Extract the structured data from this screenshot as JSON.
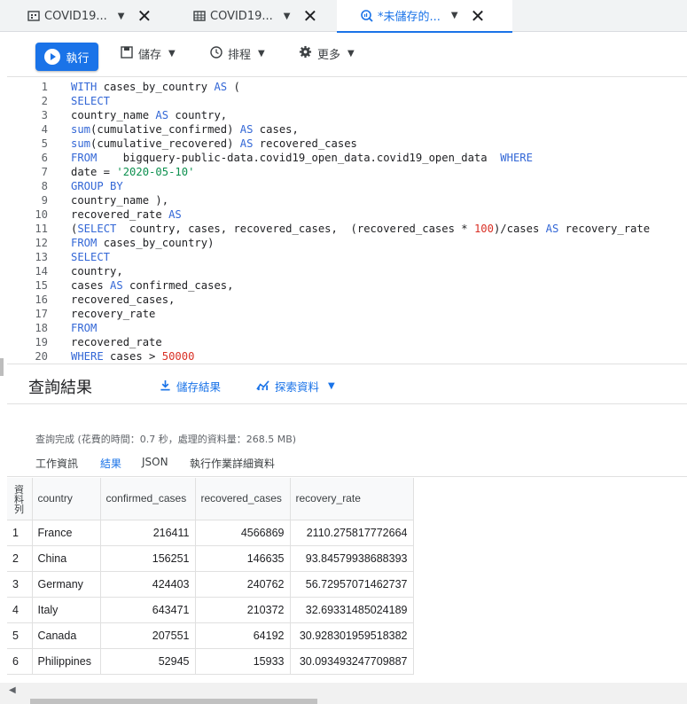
{
  "tabs": [
    {
      "label": "COVID19...",
      "icon": "dataset-icon"
    },
    {
      "label": "COVID19...",
      "icon": "table-icon"
    },
    {
      "label": "*未儲存的...",
      "icon": "query-icon"
    }
  ],
  "toolbar": {
    "run_label": "執行",
    "save_label": "儲存",
    "schedule_label": "排程",
    "more_label": "更多"
  },
  "editor": {
    "line_numbers": [
      "1",
      "2",
      "3",
      "4",
      "5",
      "6",
      "7",
      "8",
      "9",
      "10",
      "11",
      "12",
      "13",
      "14",
      "15",
      "16",
      "17",
      "18",
      "19",
      "20"
    ],
    "lines": [
      "WITH cases_by_country AS (",
      "SELECT",
      "country_name AS country,",
      "sum(cumulative_confirmed) AS cases,",
      "sum(cumulative_recovered) AS recovered_cases",
      "FROM    bigquery-public-data.covid19_open_data.covid19_open_data  WHERE",
      "date = '2020-05-10'",
      "GROUP BY",
      "country_name ),",
      "recovered_rate AS",
      "(SELECT  country, cases, recovered_cases,  (recovered_cases * 100)/cases AS recovery_rate",
      "FROM cases_by_country)",
      "SELECT",
      "country,",
      "cases AS confirmed_cases,",
      "recovered_cases,",
      "recovery_rate",
      "FROM",
      "recovered_rate",
      "WHERE cases > 50000"
    ]
  },
  "results": {
    "title": "查詢結果",
    "save_results_label": "儲存結果",
    "explore_label": "探索資料",
    "info_text": "查詢完成 (花費的時間：0.7 秒，處理的資料量：268.5 MB)",
    "subtabs": [
      "工作資訊",
      "結果",
      "JSON",
      "執行作業詳細資料"
    ],
    "active_subtab": "結果"
  },
  "table": {
    "row_header": "資料列",
    "columns": [
      "country",
      "confirmed_cases",
      "recovered_cases",
      "recovery_rate"
    ],
    "rows": [
      [
        "1",
        "France",
        "216411",
        "4566869",
        "2110.275817772664"
      ],
      [
        "2",
        "China",
        "156251",
        "146635",
        "93.84579938688393"
      ],
      [
        "3",
        "Germany",
        "424403",
        "240762",
        "56.72957071462737"
      ],
      [
        "4",
        "Italy",
        "643471",
        "210372",
        "32.69331485024189"
      ],
      [
        "5",
        "Canada",
        "207551",
        "64192",
        "30.928301959518382"
      ],
      [
        "6",
        "Philippines",
        "52945",
        "15933",
        "30.093493247709887"
      ]
    ]
  },
  "colors": {
    "accent": "#1a73e8",
    "keyword": "#3367d6",
    "string": "#0d904f",
    "number": "#d93025"
  }
}
